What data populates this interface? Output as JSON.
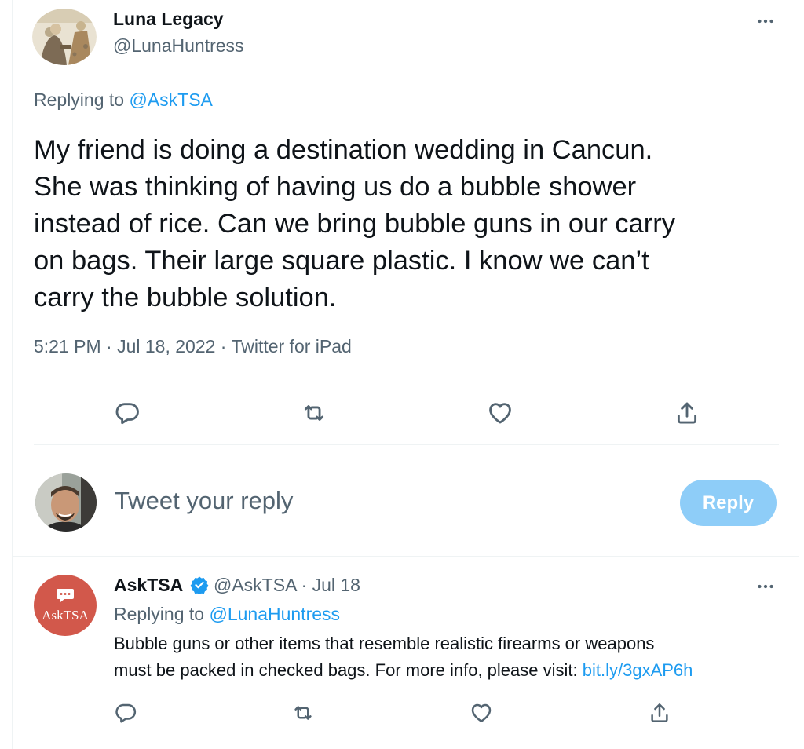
{
  "main_tweet": {
    "author_name": "Luna Legacy",
    "handle": "@LunaHuntress",
    "replying_prefix": "Replying to",
    "replying_to": "@AskTSA",
    "text_lines": [
      "My friend is doing a destination wedding in Cancun.",
      "She was thinking of having us do a bubble shower",
      "instead of rice. Can we bring bubble guns in our carry",
      "on bags. Their large square plastic. I know we can’t",
      "carry the bubble solution."
    ],
    "meta": "5:21 PM · Jul 18, 2022 · Twitter for iPad",
    "actions": [
      "reply-icon",
      "retweet-icon",
      "like-icon",
      "share-icon"
    ]
  },
  "composer": {
    "placeholder": "Tweet your reply",
    "reply_button": "Reply"
  },
  "reply_tweet": {
    "author_name": "AskTSA",
    "verified": true,
    "handle": "@AskTSA",
    "date": "· Jul 18",
    "avatar_text": "AskTSA",
    "replying_prefix": "Replying to",
    "replying_to": "@LunaHuntress",
    "text_line1": "Bubble guns or other items that resemble realistic firearms or weapons",
    "text_line2": "must be packed in checked bags. For more info, please visit:",
    "link": "bit.ly/3gxAP6h",
    "actions": [
      "reply-icon",
      "retweet-icon",
      "like-icon",
      "share-icon"
    ]
  },
  "colors": {
    "accent": "#1d9bf0",
    "reply_button_disabled": "#8ecdf8",
    "secondary_text": "#536471",
    "tsa_avatar": "#d2584b"
  }
}
